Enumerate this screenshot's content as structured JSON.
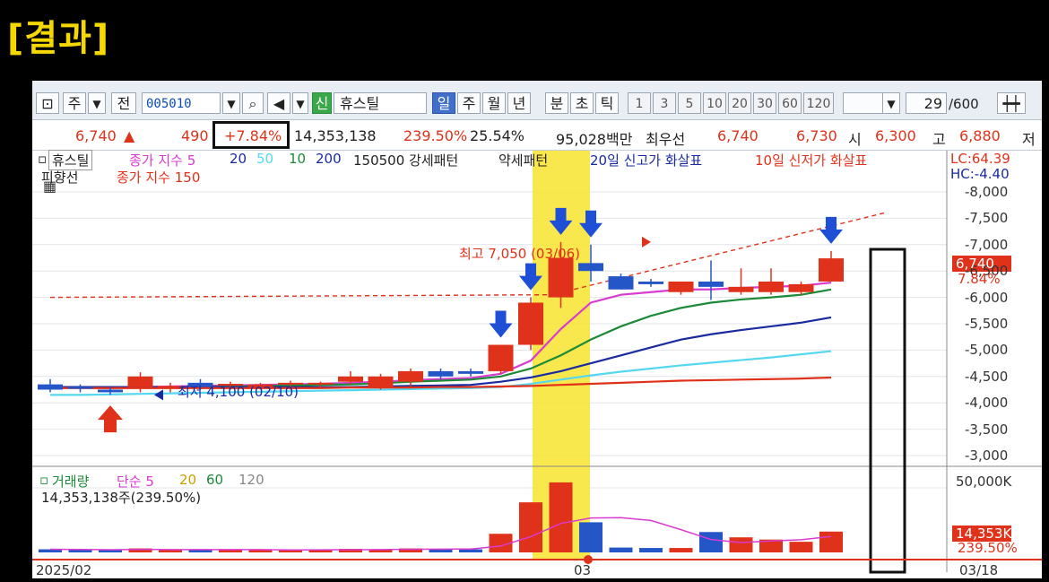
{
  "header": {
    "title": "[결과]"
  },
  "toolbar": {
    "type_label": "주",
    "prev_label": "전",
    "stock_code": "005010",
    "badge": "신",
    "stock_name": "휴스틸",
    "periods": [
      "일",
      "주",
      "월",
      "년",
      "분",
      "초",
      "틱"
    ],
    "intervals": [
      "1",
      "3",
      "5",
      "10",
      "20",
      "30",
      "60",
      "120"
    ],
    "count": "29",
    "count_total": "/600"
  },
  "quote": {
    "price": "6,740",
    "up_arrow": "▲",
    "change": "490",
    "change_pct": "+7.84%",
    "volume": "14,353,138",
    "volume_ratio": "239.50%",
    "turnover": "25.54%",
    "amount": "95,028백만",
    "best_label": "최우선",
    "ask": "6,740",
    "bid": "6,730",
    "open_label": "시",
    "open": "6,300",
    "high_label": "고",
    "high": "6,880",
    "low_label": "저"
  },
  "chart_legend": {
    "name": "휴스틸",
    "ma_label": "종가 지수 5",
    "ma20": "20",
    "ma50": "50",
    "ma10": "10",
    "ma200": "200",
    "pattern": "150500 강세패턴",
    "weak": "약세패턴",
    "newhigh": "20일 신고가 화살표",
    "newlow": "10일 신저가 화살표",
    "trend": "피향선",
    "ma150": "종가 지수 150",
    "lc": "LC:64.39",
    "hc": "HC:-4.40"
  },
  "annotations": {
    "high_label": "최고 7,050 (03/06)",
    "low_label": "최저 4,100 (02/10)"
  },
  "price_axis": {
    "ticks": [
      "8,000",
      "7,500",
      "7,000",
      "6,500",
      "6,000",
      "5,500",
      "5,000",
      "4,500",
      "4,000",
      "3,500",
      "3,000"
    ],
    "current": "6,740",
    "current_pct": "7.84%"
  },
  "volume_panel": {
    "legend_title": "거래량",
    "legend_ma": "단순 5",
    "legend_20": "20",
    "legend_60": "60",
    "legend_120": "120",
    "summary": "14,353,138주(239.50%)",
    "axis_top": "50,000K",
    "current": "14,353K",
    "current_pct": "239.50%"
  },
  "dates": {
    "start": "2025/02",
    "mid": "03",
    "end": "03/18"
  },
  "chart_data": {
    "type": "candlestick",
    "ylim": [
      3000,
      8000
    ],
    "candles": [
      {
        "o": 4350,
        "h": 4450,
        "l": 4200,
        "c": 4250
      },
      {
        "o": 4300,
        "h": 4350,
        "l": 4200,
        "c": 4280
      },
      {
        "o": 4250,
        "h": 4300,
        "l": 4150,
        "c": 4200
      },
      {
        "o": 4300,
        "h": 4580,
        "l": 4200,
        "c": 4500
      },
      {
        "o": 4300,
        "h": 4380,
        "l": 4200,
        "c": 4320
      },
      {
        "o": 4380,
        "h": 4450,
        "l": 4250,
        "c": 4300
      },
      {
        "o": 4350,
        "h": 4400,
        "l": 4250,
        "c": 4360
      },
      {
        "o": 4300,
        "h": 4380,
        "l": 4250,
        "c": 4350
      },
      {
        "o": 4350,
        "h": 4420,
        "l": 4250,
        "c": 4380
      },
      {
        "o": 4350,
        "h": 4400,
        "l": 4300,
        "c": 4380
      },
      {
        "o": 4400,
        "h": 4600,
        "l": 4350,
        "c": 4500
      },
      {
        "o": 4300,
        "h": 4550,
        "l": 4250,
        "c": 4500
      },
      {
        "o": 4400,
        "h": 4650,
        "l": 4300,
        "c": 4600
      },
      {
        "o": 4600,
        "h": 4650,
        "l": 4450,
        "c": 4500
      },
      {
        "o": 4600,
        "h": 4650,
        "l": 4500,
        "c": 4550
      },
      {
        "o": 4600,
        "h": 5100,
        "l": 4550,
        "c": 5100
      },
      {
        "o": 5100,
        "h": 6000,
        "l": 5000,
        "c": 5900
      },
      {
        "o": 6000,
        "h": 7050,
        "l": 5800,
        "c": 6750
      },
      {
        "o": 6650,
        "h": 7000,
        "l": 6300,
        "c": 6500
      },
      {
        "o": 6400,
        "h": 6450,
        "l": 6150,
        "c": 6150
      },
      {
        "o": 6300,
        "h": 6350,
        "l": 6200,
        "c": 6250
      },
      {
        "o": 6100,
        "h": 6300,
        "l": 6050,
        "c": 6300
      },
      {
        "o": 6300,
        "h": 6700,
        "l": 5950,
        "c": 6200
      },
      {
        "o": 6100,
        "h": 6550,
        "l": 6050,
        "c": 6200
      },
      {
        "o": 6100,
        "h": 6550,
        "l": 6050,
        "c": 6300
      },
      {
        "o": 6100,
        "h": 6300,
        "l": 6050,
        "c": 6250
      },
      {
        "o": 6300,
        "h": 6880,
        "l": 6300,
        "c": 6740
      }
    ],
    "volumes_k": [
      700,
      600,
      500,
      900,
      500,
      700,
      600,
      500,
      500,
      600,
      800,
      700,
      900,
      700,
      700,
      4200,
      11300,
      15800,
      6800,
      1100,
      1000,
      1000,
      4600,
      3400,
      2900,
      2400,
      4700
    ],
    "ma_series": [
      {
        "name": "5",
        "color": "#d93bd0",
        "values": [
          4300,
          4290,
          4280,
          4300,
          4310,
          4320,
          4330,
          4340,
          4350,
          4360,
          4380,
          4400,
          4430,
          4450,
          4470,
          4550,
          4800,
          5400,
          5900,
          6050,
          6100,
          6150,
          6150,
          6180,
          6200,
          6220,
          6280
        ]
      },
      {
        "name": "10",
        "color": "#1d8a38",
        "values": [
          4300,
          4300,
          4300,
          4300,
          4300,
          4300,
          4310,
          4320,
          4330,
          4340,
          4350,
          4370,
          4400,
          4420,
          4440,
          4500,
          4650,
          4900,
          5200,
          5450,
          5650,
          5800,
          5900,
          5960,
          6000,
          6050,
          6150
        ]
      },
      {
        "name": "20",
        "color": "#1a2ba0",
        "values": [
          4300,
          4300,
          4300,
          4300,
          4300,
          4300,
          4300,
          4300,
          4300,
          4300,
          4300,
          4310,
          4320,
          4330,
          4340,
          4400,
          4480,
          4600,
          4750,
          4900,
          5050,
          5200,
          5300,
          5380,
          5450,
          5520,
          5620
        ]
      },
      {
        "name": "50",
        "color": "#55d8ef",
        "values": [
          4150,
          4150,
          4160,
          4170,
          4180,
          4190,
          4200,
          4210,
          4220,
          4230,
          4240,
          4250,
          4260,
          4270,
          4280,
          4300,
          4360,
          4440,
          4520,
          4590,
          4650,
          4710,
          4760,
          4810,
          4860,
          4920,
          4980
        ]
      },
      {
        "name": "200",
        "color": "#e0321a",
        "values": [
          4280,
          4280,
          4280,
          4280,
          4280,
          4280,
          4280,
          4280,
          4280,
          4280,
          4290,
          4290,
          4290,
          4300,
          4300,
          4310,
          4320,
          4340,
          4360,
          4380,
          4400,
          4420,
          4430,
          4440,
          4450,
          4460,
          4480
        ]
      }
    ],
    "highlight_index": 17,
    "annotation_arrows_down": [
      15,
      16,
      17,
      18,
      26
    ],
    "annotation_arrow_up": 2
  }
}
